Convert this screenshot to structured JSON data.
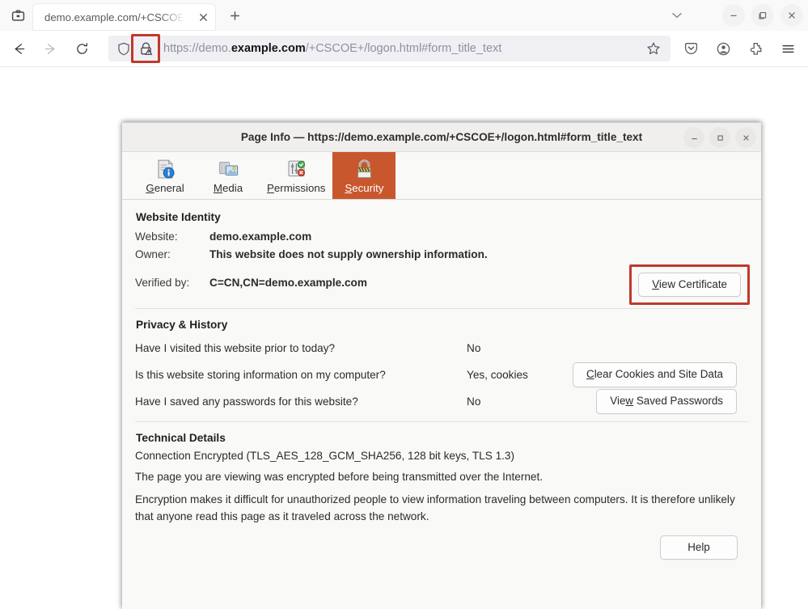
{
  "browser": {
    "firefox_view_icon": "firefox-view-icon",
    "tab": {
      "title": "demo.example.com/+CSCOE",
      "close_icon": "close-icon"
    },
    "newtab_label": "+",
    "alltabs_icon": "chevron-down-icon",
    "window_controls": {
      "minimize": "–",
      "maximize": "❐",
      "close": "✕"
    },
    "nav": {
      "back_icon": "back-arrow-icon",
      "forward_icon": "forward-arrow-icon",
      "reload_icon": "reload-icon"
    },
    "urlbar": {
      "shield_icon": "shield-icon",
      "lock_icon": "lock-warning-icon",
      "url_prefix": "https://demo.",
      "url_domain": "example.com",
      "url_suffix": "/+CSCOE+/logon.html#form_title_text",
      "full_url": "https://demo.example.com/+CSCOE+/logon.html#form_title_text",
      "bookmark_icon": "star-icon",
      "highlight_color": "#c0392b"
    },
    "toolbar_right": {
      "pocket_icon": "save-to-pocket-icon",
      "account_icon": "account-circle-icon",
      "extensions_icon": "extensions-puzzle-icon",
      "menu_icon": "hamburger-menu-icon"
    }
  },
  "dialog": {
    "title": "Page Info — https://demo.example.com/+CSCOE+/logon.html#form_title_text",
    "window_controls": {
      "minimize": "–",
      "maximize": "□",
      "close": "✕"
    },
    "accent_color": "#c8572e",
    "tabs": [
      {
        "label_pre": "",
        "label_key": "G",
        "label_post": "eneral",
        "icon": "page-info-general-icon",
        "active": false
      },
      {
        "label_pre": "",
        "label_key": "M",
        "label_post": "edia",
        "icon": "page-info-media-icon",
        "active": false
      },
      {
        "label_pre": "",
        "label_key": "P",
        "label_post": "ermissions",
        "icon": "page-info-permissions-icon",
        "active": false
      },
      {
        "label_pre": "",
        "label_key": "S",
        "label_post": "ecurity",
        "icon": "page-info-security-icon",
        "active": true
      }
    ],
    "identity": {
      "heading": "Website Identity",
      "website_label": "Website:",
      "website_value": "demo.example.com",
      "owner_label": "Owner:",
      "owner_value": "This website does not supply ownership information.",
      "verified_label": "Verified by:",
      "verified_value": "C=CN,CN=demo.example.com",
      "cert_button_key": "V",
      "cert_button_rest": "iew Certificate",
      "cert_button_label": "View Certificate"
    },
    "privacy": {
      "heading": "Privacy & History",
      "rows": [
        {
          "question": "Have I visited this website prior to today?",
          "answer": "No",
          "button": null
        },
        {
          "question": "Is this website storing information on my computer?",
          "answer": "Yes, cookies",
          "button": {
            "pre": "",
            "key": "C",
            "post": "lear Cookies and Site Data",
            "label": "Clear Cookies and Site Data"
          }
        },
        {
          "question": "Have I saved any passwords for this website?",
          "answer": "No",
          "button": {
            "pre": "Vie",
            "key": "w",
            "post": " Saved Passwords",
            "label": "View Saved Passwords"
          }
        }
      ]
    },
    "technical": {
      "heading": "Technical Details",
      "line1": "Connection Encrypted (TLS_AES_128_GCM_SHA256, 128 bit keys, TLS 1.3)",
      "line2": "The page you are viewing was encrypted before being transmitted over the Internet.",
      "line3": "Encryption makes it difficult for unauthorized people to view information traveling between computers. It is therefore unlikely that anyone read this page as it traveled across the network."
    },
    "help_button_label": "Help"
  }
}
